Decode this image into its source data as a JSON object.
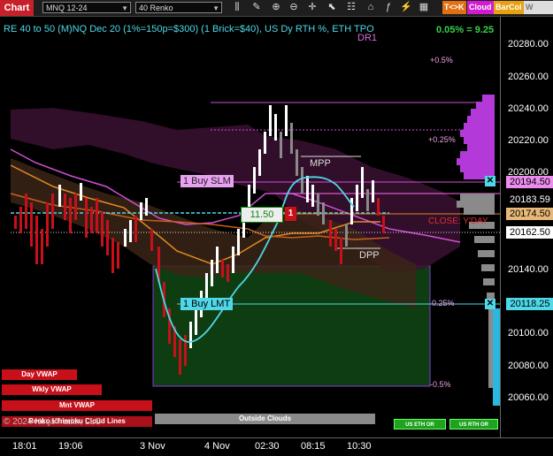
{
  "toolbar": {
    "chart_label": "Chart",
    "instrument": "MNQ 12-24",
    "bar_type": "40 Renko",
    "pills": {
      "tk": "T<>K",
      "cloud": "Cloud",
      "barcol": "BarCol",
      "vwap": "W VWAP"
    }
  },
  "chart": {
    "title": "RE 40 to 50 (M)NQ Dec 20 (1%=150p=$300) (1 Brick=$40), US Dy RTH %, ETH TPO",
    "daily_change": "0.05% = 9.25",
    "labels": {
      "dr1": "DR1",
      "plus_half": "+0.5%",
      "plus_quarter": "+0.25%",
      "mpp": "MPP",
      "dpp": "DPP",
      "close_yday": "CLOSE: Y'DAY",
      "minus_quarter": "0.25%",
      "minus_half": "-0.5%",
      "order_price": "11.50",
      "order_qty": "1",
      "buy_slm": "1 Buy SLM",
      "buy_lmt": "1 Buy LMT",
      "copyright": "© 2024 NinjaTrader, LLC",
      "overlay_label": "Renko Ichimoku Cloud Lines",
      "outside_clouds": "Outside Clouds"
    },
    "buttons": {
      "day_vwap": "Day VWAP",
      "wkly_vwap": "Wkly VWAP",
      "mnt_vwap": "Mnt VWAP",
      "us_eth": "US ETH OR",
      "us_rth": "US RTH OR"
    }
  },
  "yaxis": {
    "ticks": [
      "20280.00",
      "20260.00",
      "20240.00",
      "20220.00",
      "20200.00",
      "20140.00",
      "20100.00",
      "20080.00",
      "20060.00"
    ],
    "flags": {
      "f1": "20194.50",
      "f2": "20183.59",
      "f3": "20174.50",
      "f4": "20162.50",
      "f5": "20118.25"
    }
  },
  "xaxis": {
    "ticks": [
      "18:01",
      "19:06",
      "3 Nov",
      "4 Nov",
      "02:30",
      "08:15",
      "10:30"
    ]
  },
  "colors": {
    "cyan": "#4fd8e8",
    "magenta": "#d24fd6",
    "orange": "#e08a20",
    "green_box": "#0f3d12",
    "red": "#c8101a"
  }
}
